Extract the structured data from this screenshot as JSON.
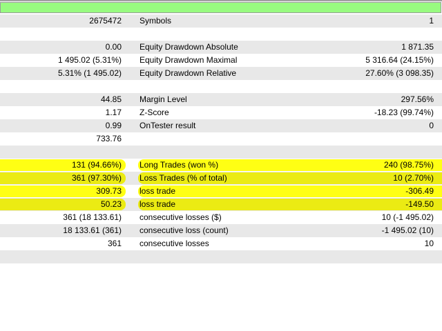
{
  "progress": {
    "percent": 100,
    "color": "#98fb80"
  },
  "rows": [
    {
      "v1": "2675472",
      "label": "Symbols",
      "v2": "1"
    },
    {
      "v1": "",
      "label": "",
      "v2": ""
    },
    {
      "v1": "0.00",
      "label": "Equity Drawdown Absolute",
      "v2": "1 871.35"
    },
    {
      "v1": "1 495.02 (5.31%)",
      "label": "Equity Drawdown Maximal",
      "v2": "5 316.64 (24.15%)"
    },
    {
      "v1": "5.31% (1 495.02)",
      "label": "Equity Drawdown Relative",
      "v2": "27.60% (3 098.35)"
    },
    {
      "v1": "",
      "label": "",
      "v2": ""
    },
    {
      "v1": "44.85",
      "label": "Margin Level",
      "v2": "297.56%"
    },
    {
      "v1": "1.17",
      "label": "Z-Score",
      "v2": "-18.23 (99.74%)"
    },
    {
      "v1": "0.99",
      "label": "OnTester result",
      "v2": "0"
    },
    {
      "v1": "733.76",
      "label": "",
      "v2": ""
    },
    {
      "v1": "",
      "label": "",
      "v2": ""
    },
    {
      "v1": "131 (94.66%)",
      "label": "Long Trades (won %)",
      "v2": "240 (98.75%)",
      "highlight": true
    },
    {
      "v1": "361 (97.30%)",
      "label": "Loss Trades (% of total)",
      "v2": "10 (2.70%)",
      "highlight": true
    },
    {
      "v1": "309.73",
      "label": "loss trade",
      "v2": "-306.49",
      "highlight": true
    },
    {
      "v1": "50.23",
      "label": "loss trade",
      "v2": "-149.50",
      "highlight": true
    },
    {
      "v1": "361 (18 133.61)",
      "label": "consecutive losses ($)",
      "v2": "10 (-1 495.02)"
    },
    {
      "v1": "18 133.61 (361)",
      "label": "consecutive loss (count)",
      "v2": "-1 495.02 (10)"
    },
    {
      "v1": "361",
      "label": "consecutive losses",
      "v2": "10"
    },
    {
      "v1": "",
      "label": "",
      "v2": ""
    }
  ],
  "highlight_color": "#ffff00"
}
